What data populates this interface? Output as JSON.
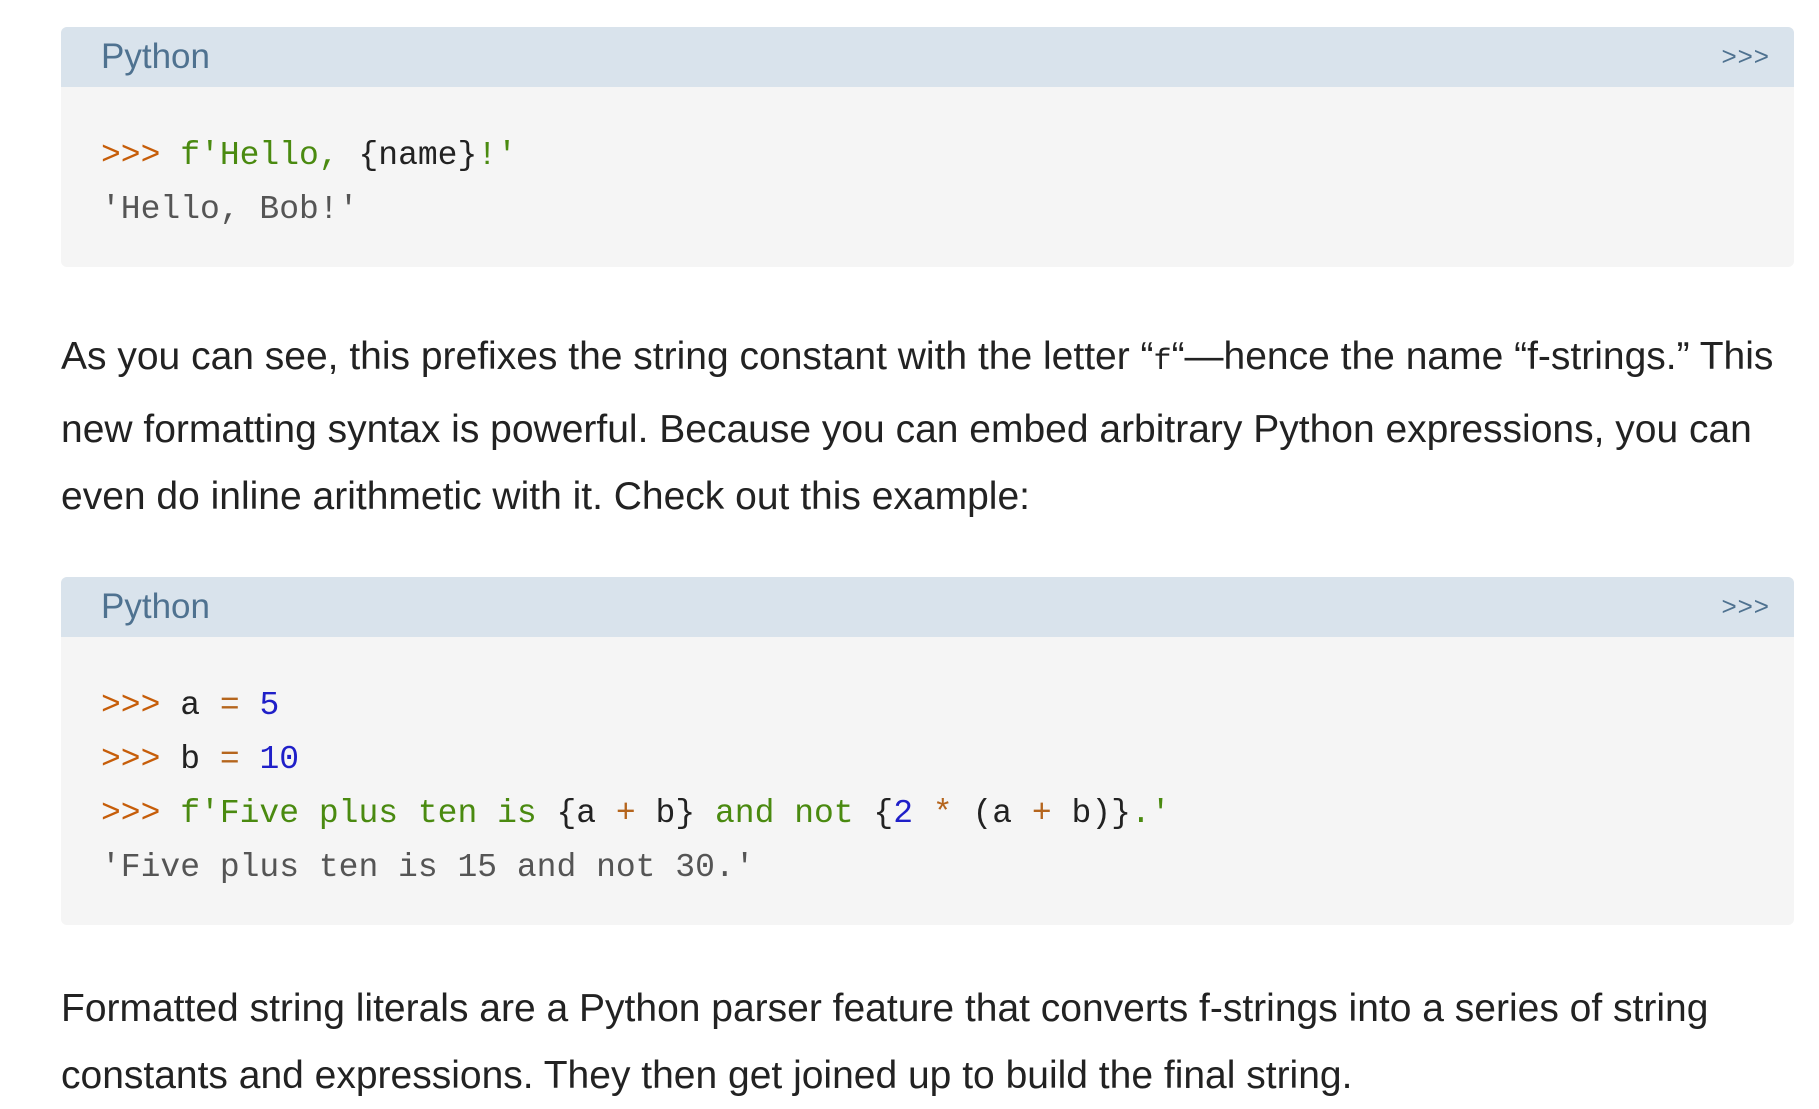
{
  "block1": {
    "language": "Python",
    "prompt_toggle": ">>>",
    "line1": {
      "prompt": ">>> ",
      "str_open": "f'Hello, ",
      "brace_open": "{",
      "var": "name",
      "brace_close": "}",
      "str_close": "!'"
    },
    "output": "'Hello, Bob!'"
  },
  "para1": {
    "text_a": "As you can see, this prefixes the string constant with the letter “",
    "code": "f",
    "text_b": "“—hence the name “f-strings.” This new formatting syntax is powerful. Because you can embed arbitrary Python expressions, you can even do inline arithmetic with it. Check out this example:"
  },
  "block2": {
    "language": "Python",
    "prompt_toggle": ">>>",
    "line1": {
      "prompt": ">>> ",
      "var": "a",
      "op": "=",
      "num": "5"
    },
    "line2": {
      "prompt": ">>> ",
      "var": "b",
      "op": "=",
      "num": "10"
    },
    "line3": {
      "prompt": ">>> ",
      "str_a": "f'Five plus ten is ",
      "brace1_open": "{",
      "expr1_a": "a",
      "expr1_op": "+",
      "expr1_b": "b",
      "brace1_close": "}",
      "str_b": " and not ",
      "brace2_open": "{",
      "expr2_num": "2",
      "expr2_op": "*",
      "expr2_paren_open": "(a",
      "expr2_op2": "+",
      "expr2_paren_close": "b)",
      "brace2_close": "}",
      "str_c": ".'"
    },
    "output": "'Five plus ten is 15 and not 30.'"
  },
  "para2": {
    "text": "Formatted string literals are a Python parser feature that converts f-strings into a series of string constants and expressions. They then get joined up to build the final string."
  }
}
